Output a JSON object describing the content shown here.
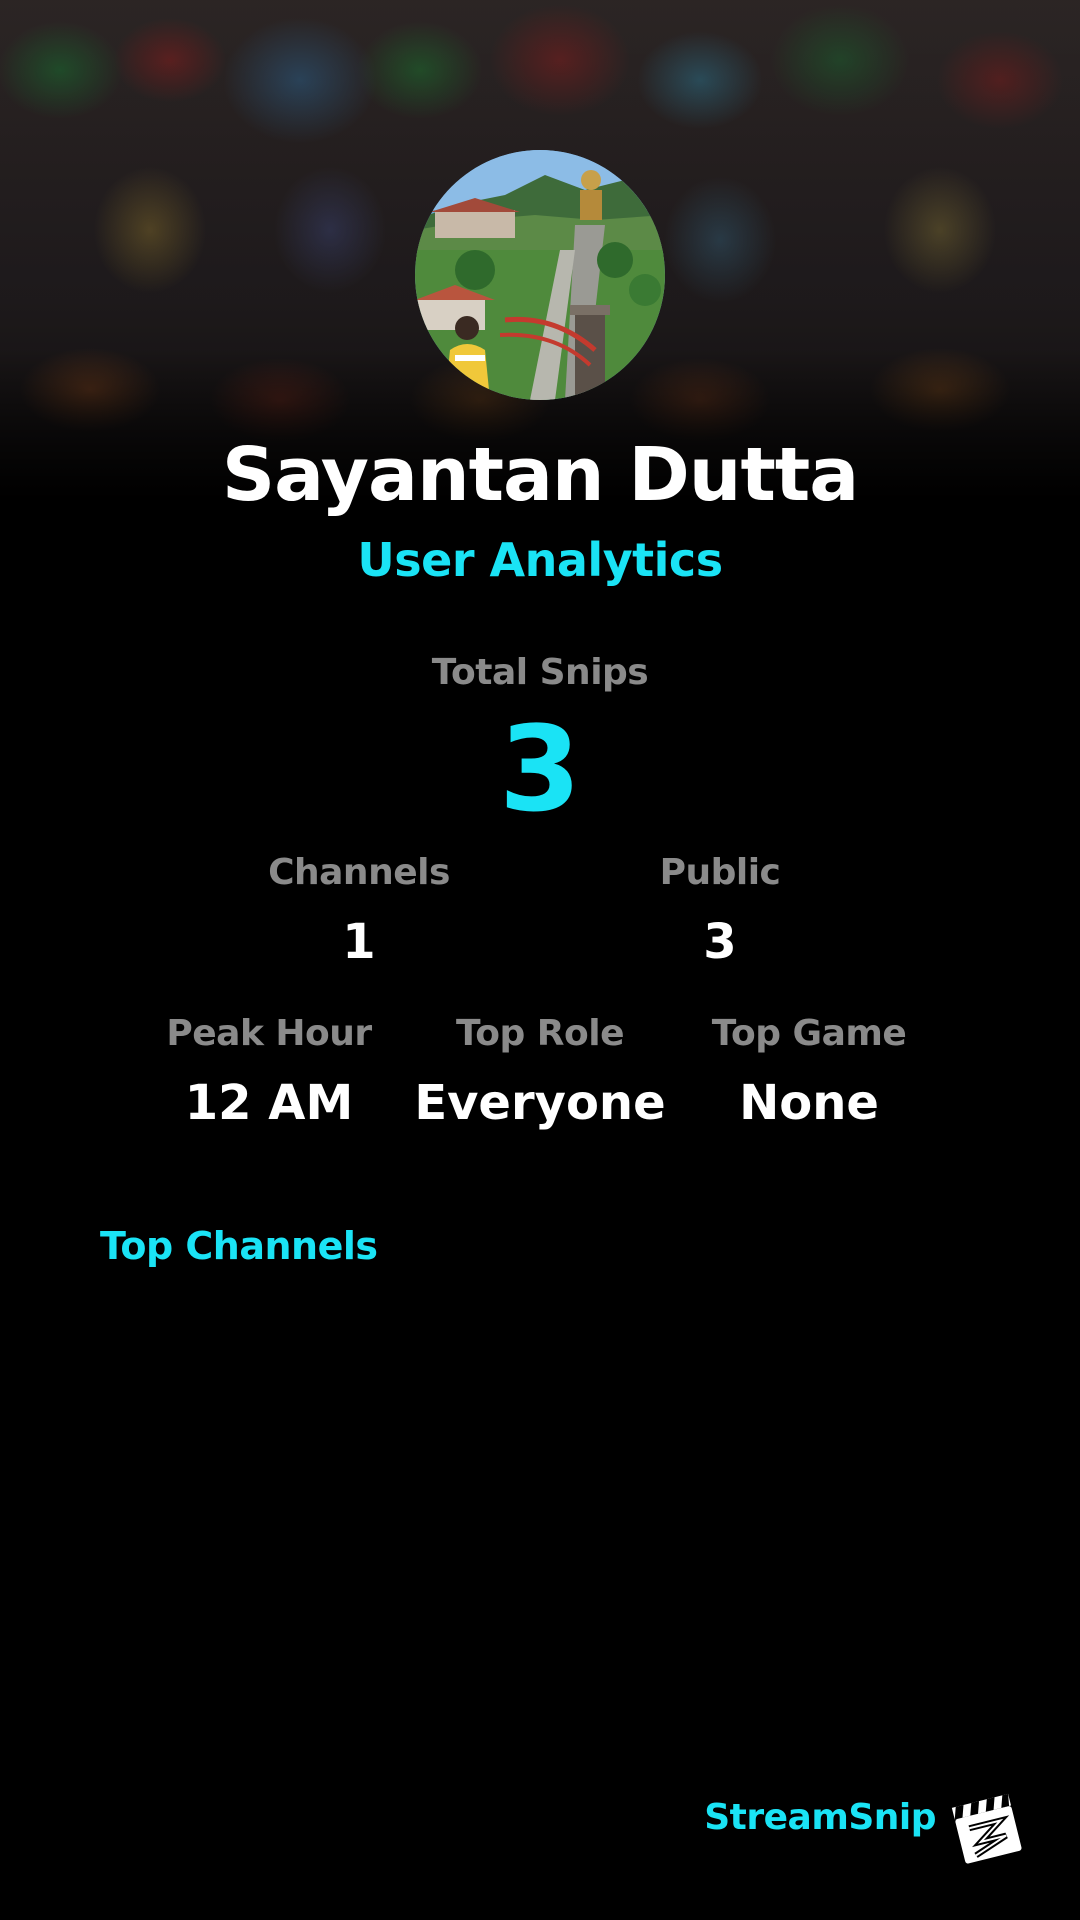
{
  "profile": {
    "name": "Sayantan Dutta",
    "subtitle": "User Analytics"
  },
  "stats": {
    "total_snips": {
      "label": "Total Snips",
      "value": "3"
    },
    "channels": {
      "label": "Channels",
      "value": "1"
    },
    "public": {
      "label": "Public",
      "value": "3"
    },
    "peak_hour": {
      "label": "Peak Hour",
      "value": "12 AM"
    },
    "top_role": {
      "label": "Top Role",
      "value": "Everyone"
    },
    "top_game": {
      "label": "Top Game",
      "value": "None"
    }
  },
  "top_channels": {
    "title": "Top Channels",
    "items": []
  },
  "footer": {
    "brand": "StreamSnip",
    "logo_icon": "clapperboard-icon"
  },
  "colors": {
    "background": "#000000",
    "accent": "#1ae3f5",
    "label_gray": "#8a8a8a",
    "text": "#ffffff"
  }
}
